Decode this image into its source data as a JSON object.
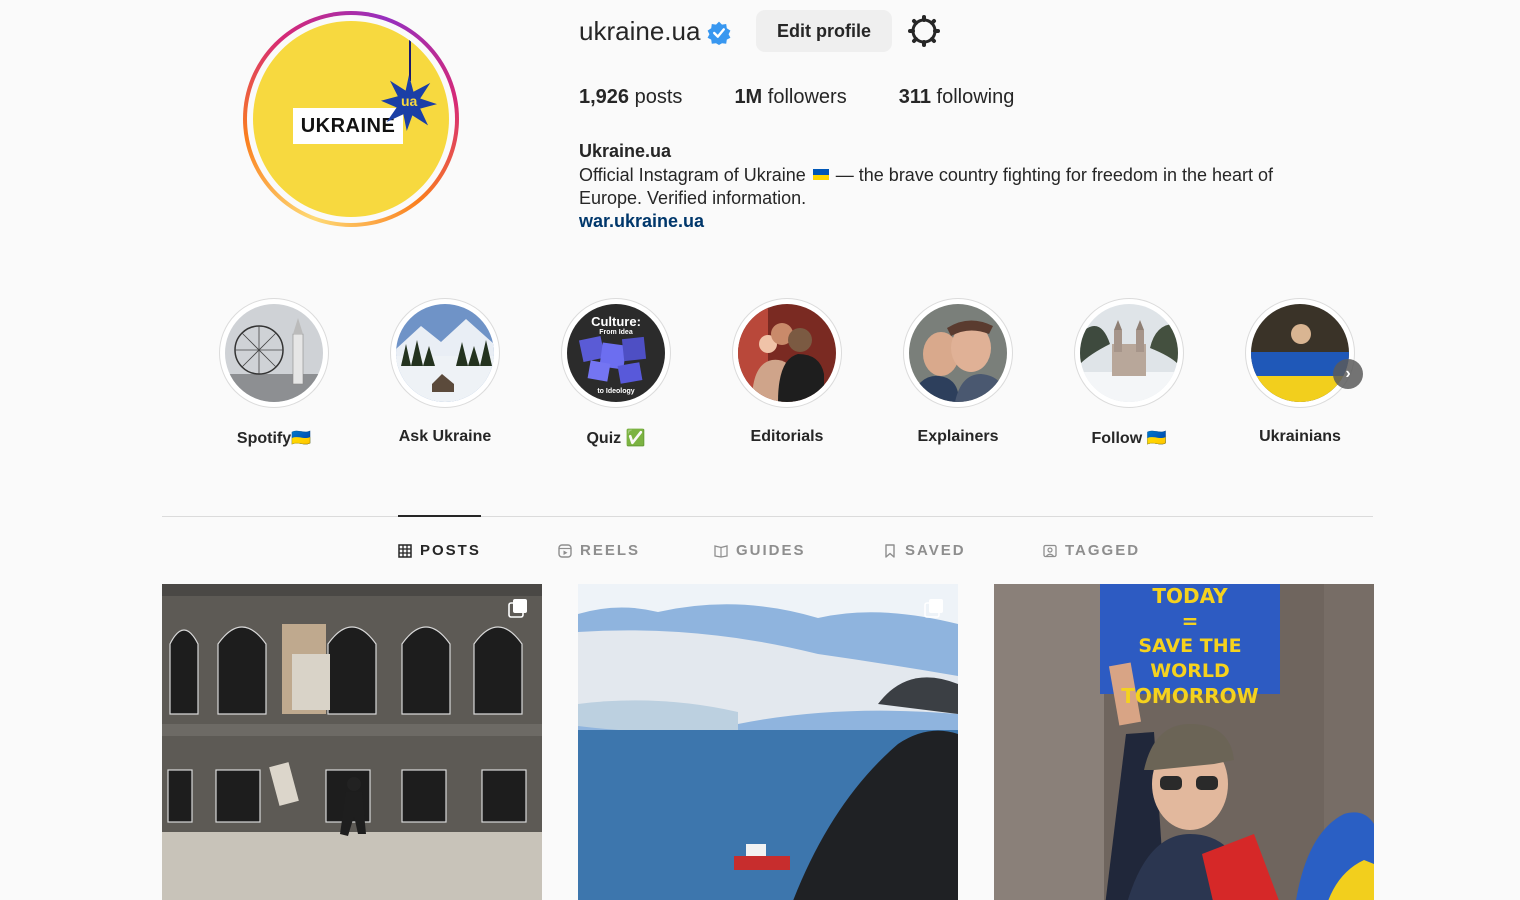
{
  "profile": {
    "username": "ukraine.ua",
    "avatar_text": "UKRAINE",
    "avatar_badge": "ua",
    "edit_button": "Edit profile",
    "stats": {
      "posts_count": "1,926",
      "posts_label": "posts",
      "followers_count": "1M",
      "followers_label": "followers",
      "following_count": "311",
      "following_label": "following"
    },
    "full_name": "Ukraine.ua",
    "bio_part1": "Official Instagram of Ukraine",
    "bio_part2": " — the brave country fighting for freedom in the heart of Europe. Verified information.",
    "link": "war.ukraine.ua"
  },
  "highlights": [
    {
      "label": "Spotify🇺🇦"
    },
    {
      "label": "Ask Ukraine"
    },
    {
      "label": "Quiz ✅"
    },
    {
      "label": "Editorials"
    },
    {
      "label": "Explainers"
    },
    {
      "label": "Follow 🇺🇦"
    },
    {
      "label": "Ukrainians"
    }
  ],
  "highlight_quiz_text": {
    "title": "Culture:",
    "line1": "From Idea",
    "line2": "to Ideology"
  },
  "tabs": [
    {
      "label": "POSTS",
      "icon": "grid-icon",
      "active": true
    },
    {
      "label": "REELS",
      "icon": "reels-icon",
      "active": false
    },
    {
      "label": "GUIDES",
      "icon": "guides-icon",
      "active": false
    },
    {
      "label": "SAVED",
      "icon": "bookmark-icon",
      "active": false
    },
    {
      "label": "TAGGED",
      "icon": "tagged-icon",
      "active": false
    }
  ],
  "posts": {
    "post3_sign_line1": "TODAY",
    "post3_sign_line2": "=",
    "post3_sign_line3": "SAVE THE WORLD",
    "post3_sign_line4": "TOMORROW"
  },
  "colors": {
    "verified": "#3897f0",
    "link": "#00376b",
    "flag_blue": "#0057b7",
    "flag_yellow": "#ffd700"
  }
}
